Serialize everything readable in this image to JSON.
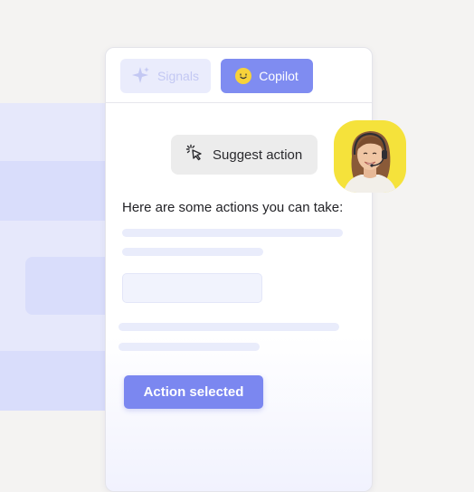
{
  "tabs": {
    "signals_label": "Signals",
    "copilot_label": "Copilot"
  },
  "chat": {
    "suggest_label": "Suggest action",
    "intro_text": "Here are some actions you can take:",
    "action_button_label": "Action selected"
  },
  "colors": {
    "accent": "#7b87f0",
    "avatar_bg": "#f5e23b",
    "background": "#f4f3f2"
  },
  "icons": {
    "signals": "sparkle-icon",
    "copilot": "smiley-face-icon",
    "suggest": "cursor-click-icon"
  }
}
